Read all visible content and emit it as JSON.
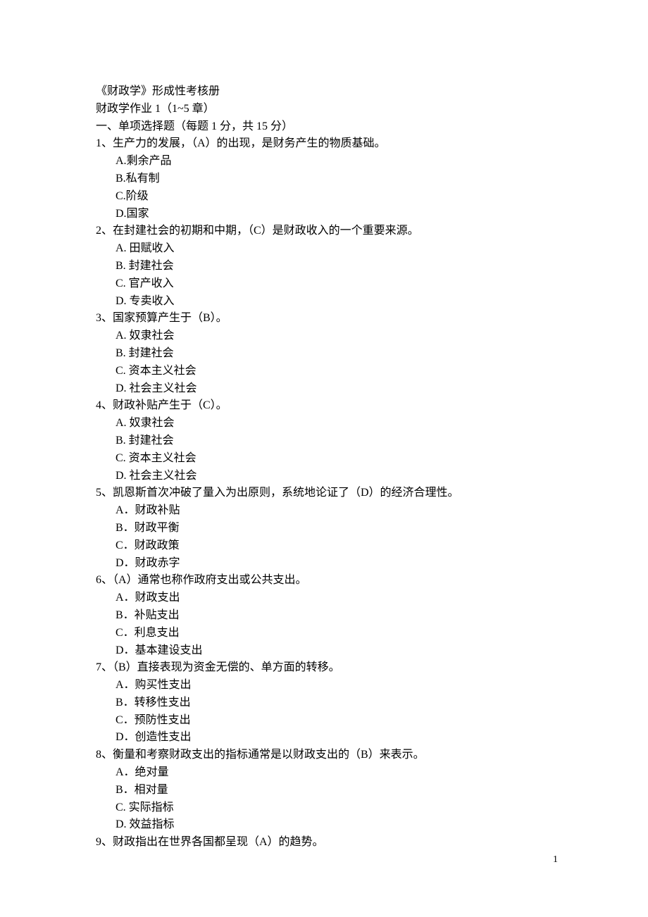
{
  "header": {
    "title": "《财政学》形成性考核册",
    "assignment": "财政学作业 1（1~5 章）",
    "section": "一、单项选择题（每题 1 分，共 15 分）"
  },
  "questions": [
    {
      "stem": "1、生产力的发展，（A）的出现，是财务产生的物质基础。",
      "options": [
        "A.剩余产品",
        "B.私有制",
        "C.阶级",
        "D.国家"
      ]
    },
    {
      "stem": "2、在封建社会的初期和中期，（C）是财政收入的一个重要来源。",
      "options": [
        "A. 田赋收入",
        "B. 封建社会",
        "C. 官产收入",
        "D. 专卖收入"
      ]
    },
    {
      "stem": "3、国家预算产生于（B）。",
      "options": [
        "A. 奴隶社会",
        "B. 封建社会",
        "C. 资本主义社会",
        "D. 社会主义社会"
      ]
    },
    {
      "stem": "4、财政补贴产生于（C）。",
      "options": [
        "A. 奴隶社会",
        "B. 封建社会",
        "C. 资本主义社会",
        "D. 社会主义社会"
      ]
    },
    {
      "stem": "5、凯恩斯首次冲破了量入为出原则，系统地论证了（D）的经济合理性。",
      "options": [
        "A．财政补贴",
        "B．财政平衡",
        "C．财政政策",
        "D．财政赤字"
      ]
    },
    {
      "stem": "6、（A）通常也称作政府支出或公共支出。",
      "options": [
        "A．财政支出",
        "B．补贴支出",
        "C．利息支出",
        "D．基本建设支出"
      ]
    },
    {
      "stem": "7、（B）直接表现为资金无偿的、单方面的转移。",
      "options": [
        "A．购买性支出",
        "B．转移性支出",
        "C．预防性支出",
        "D．创造性支出"
      ]
    },
    {
      "stem": "8、衡量和考察财政支出的指标通常是以财政支出的（B）来表示。",
      "options": [
        "A．绝对量",
        "B．相对量",
        "C. 实际指标",
        "D. 效益指标"
      ]
    },
    {
      "stem": "9、财政指出在世界各国都呈现（A）的趋势。",
      "options": []
    }
  ],
  "pageNumber": "1"
}
